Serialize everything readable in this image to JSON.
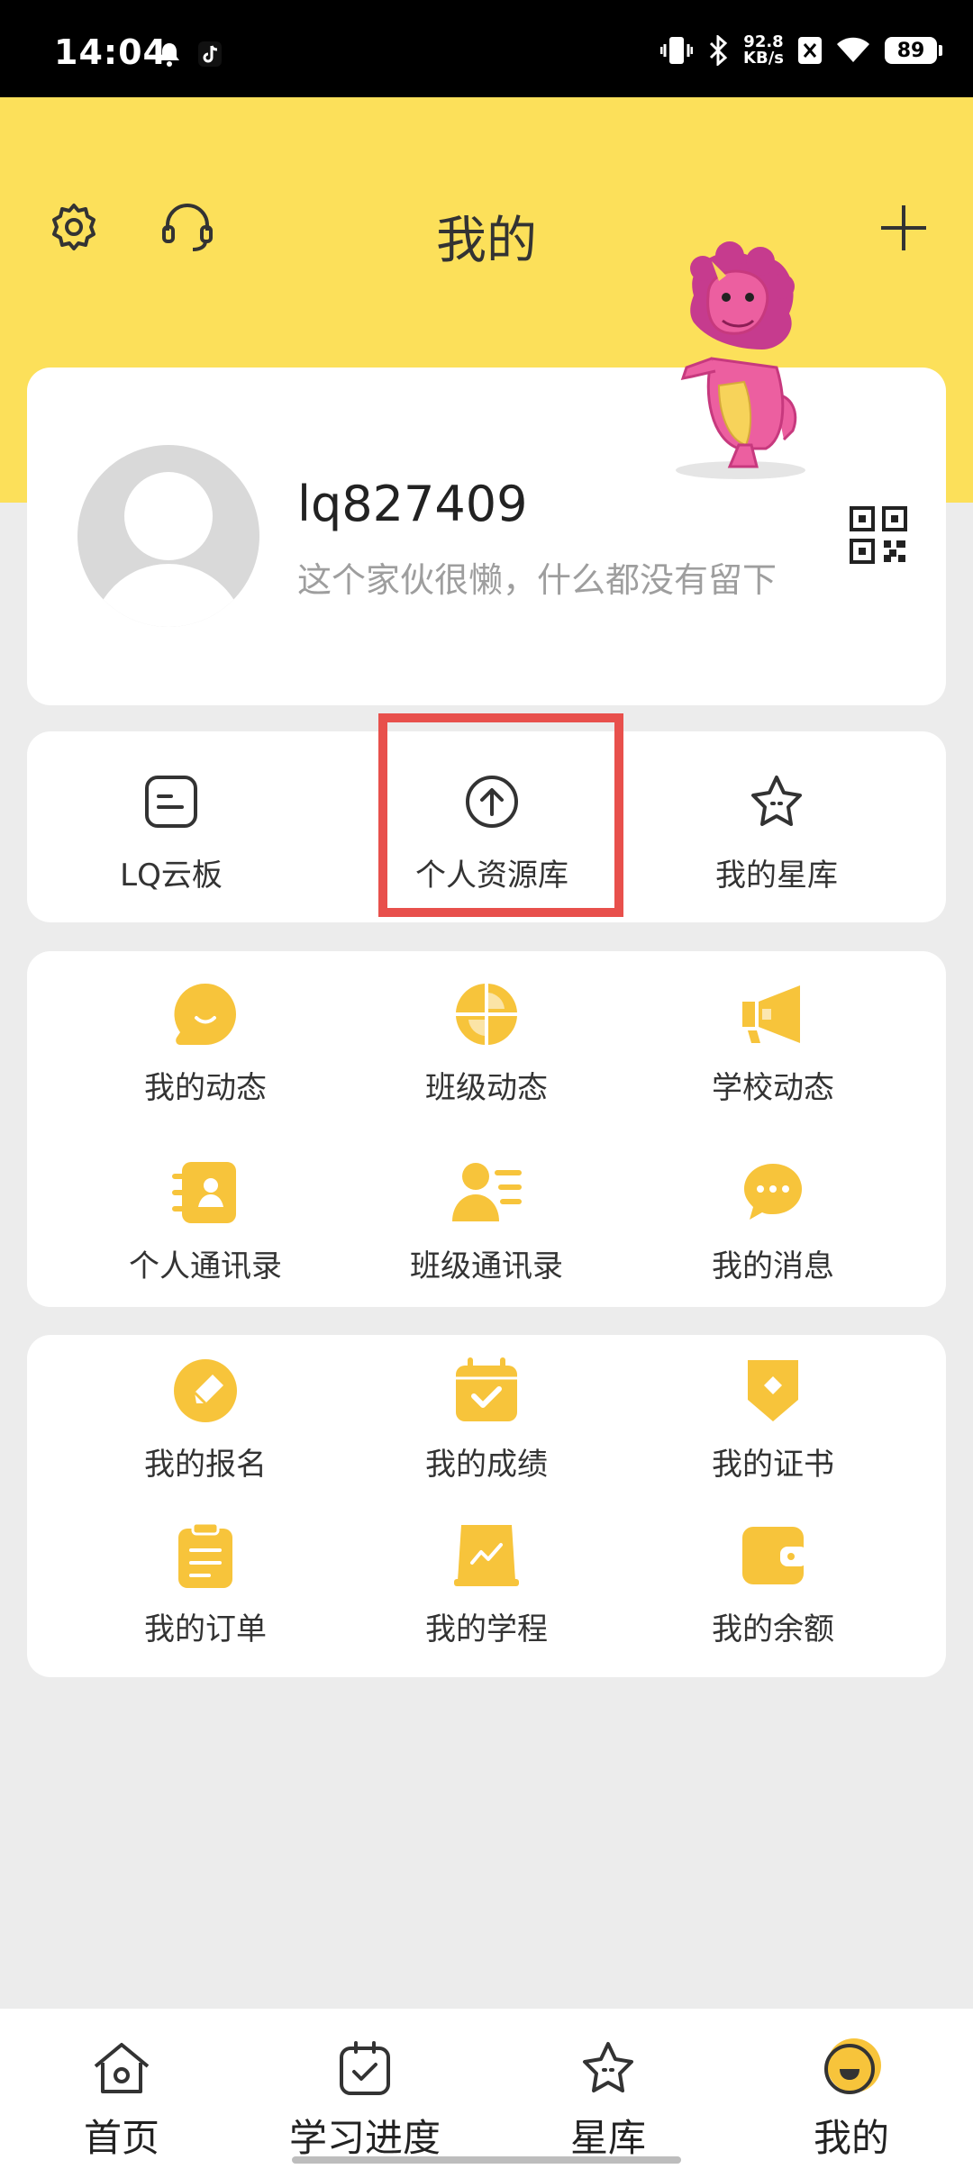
{
  "status_bar": {
    "time": "14:04",
    "net_speed_value": "92.8",
    "net_speed_unit": "KB/s",
    "battery": "89"
  },
  "header": {
    "title": "我的"
  },
  "profile": {
    "username": "lq827409",
    "bio": "这个家伙很懒，什么都没有留下"
  },
  "quick_actions": [
    {
      "label": "LQ云板",
      "icon": "whiteboard-icon"
    },
    {
      "label": "个人资源库",
      "icon": "upload-circle-icon"
    },
    {
      "label": "我的星库",
      "icon": "star-icon"
    }
  ],
  "section2": [
    {
      "label": "我的动态",
      "icon": "smile-bubble-icon"
    },
    {
      "label": "班级动态",
      "icon": "pinwheel-icon"
    },
    {
      "label": "学校动态",
      "icon": "megaphone-icon"
    },
    {
      "label": "个人通讯录",
      "icon": "contact-book-icon"
    },
    {
      "label": "班级通讯录",
      "icon": "class-contacts-icon"
    },
    {
      "label": "我的消息",
      "icon": "message-icon"
    }
  ],
  "section3": [
    {
      "label": "我的报名",
      "icon": "pencil-icon"
    },
    {
      "label": "我的成绩",
      "icon": "calendar-check-icon"
    },
    {
      "label": "我的证书",
      "icon": "certificate-icon"
    },
    {
      "label": "我的订单",
      "icon": "clipboard-icon"
    },
    {
      "label": "我的学程",
      "icon": "chart-icon"
    },
    {
      "label": "我的余额",
      "icon": "wallet-icon"
    }
  ],
  "bottom_nav": [
    {
      "label": "首页",
      "icon": "home-icon"
    },
    {
      "label": "学习进度",
      "icon": "progress-icon"
    },
    {
      "label": "星库",
      "icon": "star-icon"
    },
    {
      "label": "我的",
      "icon": "me-icon"
    }
  ],
  "colors": {
    "header_bg": "#FCE05A",
    "accent": "#F7C43B",
    "highlight_border": "#E8504C",
    "page_bg": "#ECECEC"
  }
}
